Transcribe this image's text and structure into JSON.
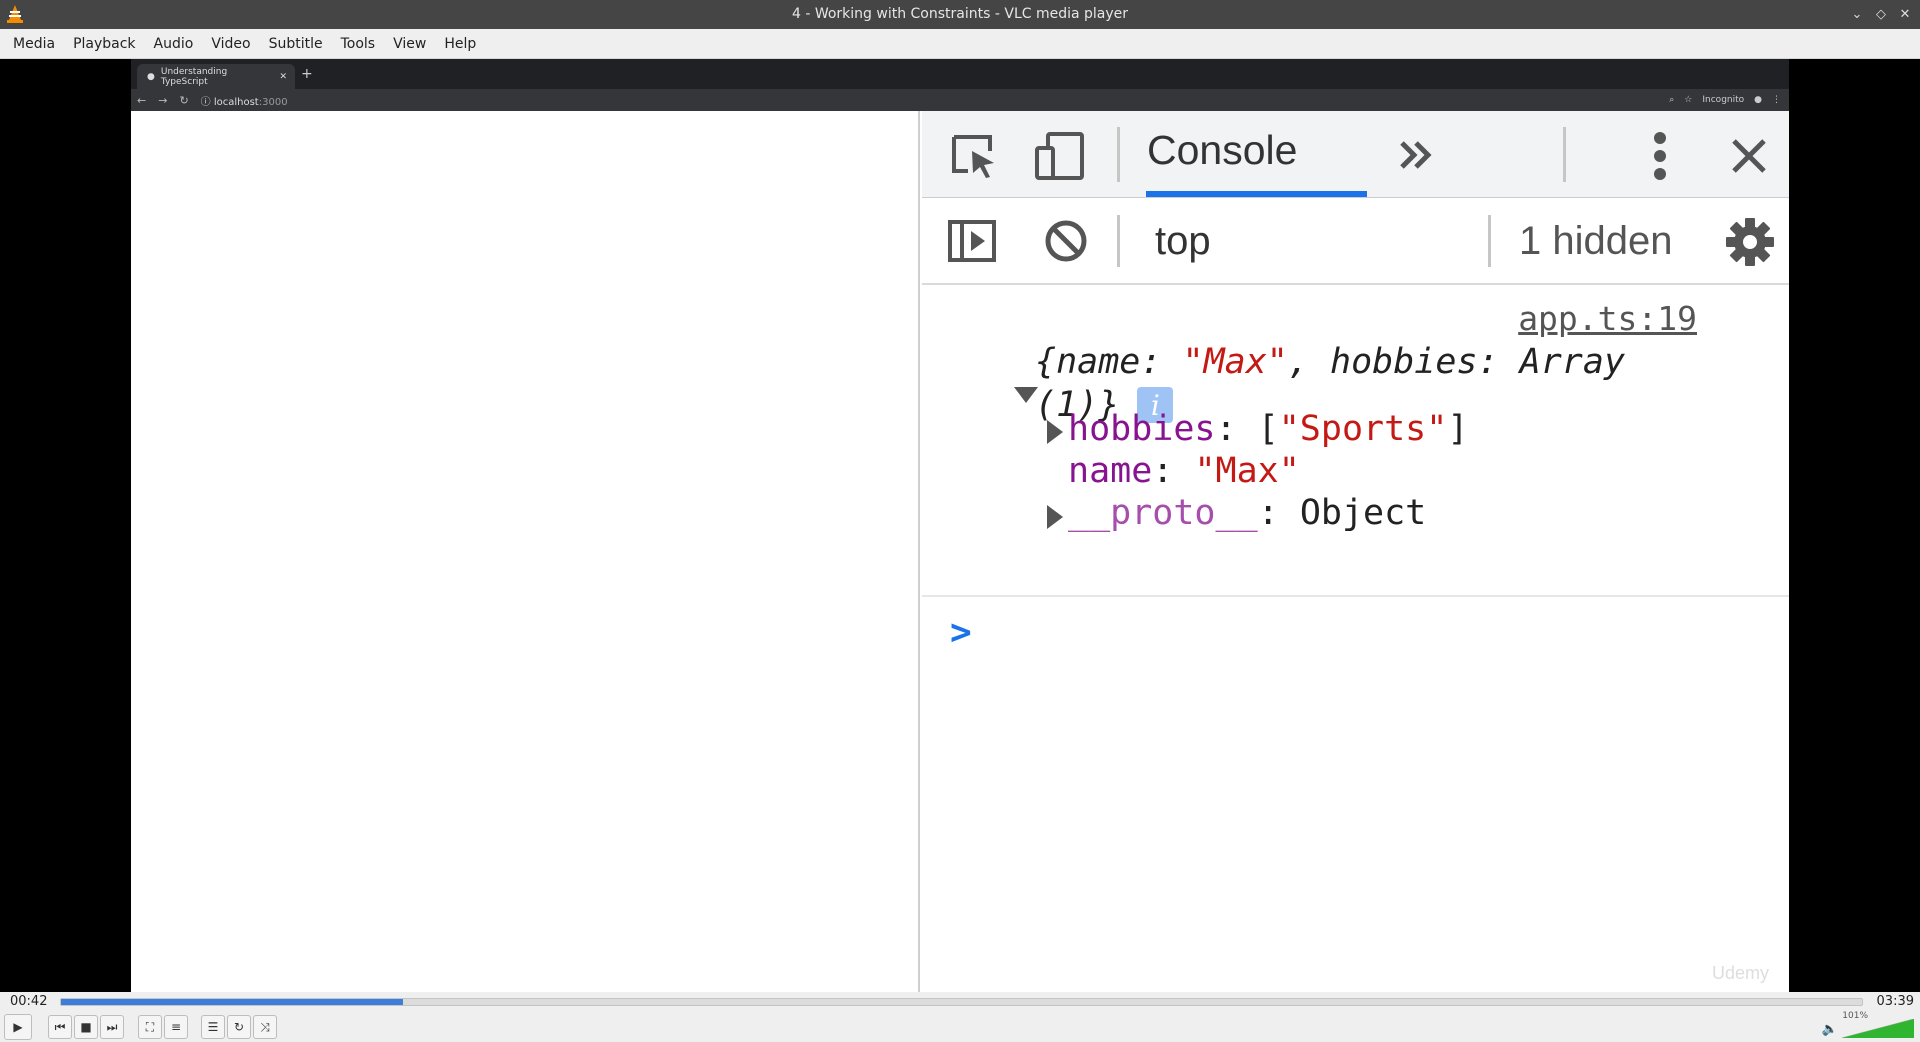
{
  "window": {
    "title": "4 - Working with Constraints - VLC media player"
  },
  "menu": [
    "Media",
    "Playback",
    "Audio",
    "Video",
    "Subtitle",
    "Tools",
    "View",
    "Help"
  ],
  "browser": {
    "tab_title": "Understanding TypeScript",
    "url_host": "localhost",
    "url_port": ":3000",
    "incognito_label": "Incognito"
  },
  "devtools": {
    "active_tab": "Console",
    "context": "top",
    "hidden_count": "1 hidden",
    "source_link": "app.ts:19",
    "object_summary": {
      "open": "{name: ",
      "name_value": "\"Max\"",
      "mid": ", hobbies: Array",
      "tail": "(1)}"
    },
    "properties": [
      {
        "key": "hobbies",
        "sep": ": [",
        "value": "\"Sports\"",
        "end": "]",
        "expandable": true
      },
      {
        "key": "name",
        "sep": ": ",
        "value": "\"Max\"",
        "end": "",
        "expandable": false
      },
      {
        "key": "__proto__",
        "sep": ": ",
        "value": "Object",
        "end": "",
        "expandable": true
      }
    ],
    "prompt": ">"
  },
  "watermark": "Udemy",
  "player": {
    "elapsed": "00:42",
    "total": "03:39",
    "progress": 0.19,
    "volume_label": "101%",
    "volume": 1.01,
    "accent_color": "#3d7fd8"
  }
}
